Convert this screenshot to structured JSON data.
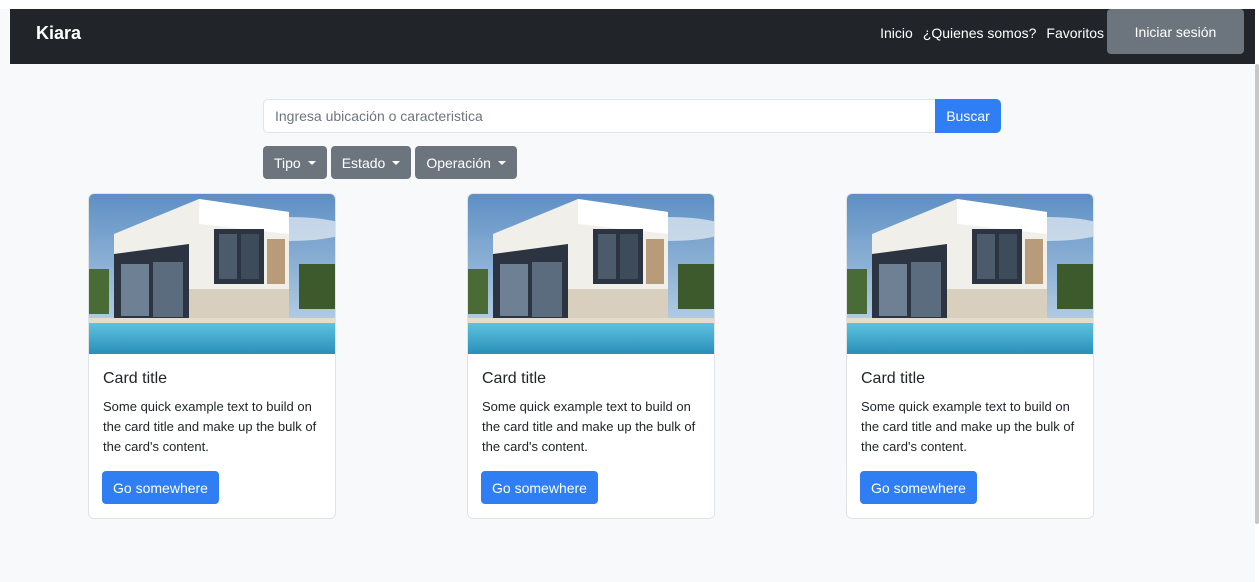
{
  "navbar": {
    "brand": "Kiara",
    "links": [
      "Inicio",
      "¿Quienes somos?",
      "Favoritos"
    ],
    "login_label": "Iniciar sesión"
  },
  "search": {
    "placeholder": "Ingresa ubicación o caracteristica",
    "value": "",
    "button_label": "Buscar"
  },
  "filters": [
    {
      "label": "Tipo"
    },
    {
      "label": "Estado"
    },
    {
      "label": "Operación"
    }
  ],
  "cards": [
    {
      "title": "Card title",
      "text": "Some quick example text to build on the card title and make up the bulk of the card's content.",
      "button_label": "Go somewhere"
    },
    {
      "title": "Card title",
      "text": "Some quick example text to build on the card title and make up the bulk of the card's content.",
      "button_label": "Go somewhere"
    },
    {
      "title": "Card title",
      "text": "Some quick example text to build on the card title and make up the bulk of the card's content.",
      "button_label": "Go somewhere"
    }
  ],
  "colors": {
    "navbar_bg": "#212529",
    "page_bg": "#f8f9fa",
    "primary": "#2f7ef3",
    "secondary": "#6c757d"
  }
}
